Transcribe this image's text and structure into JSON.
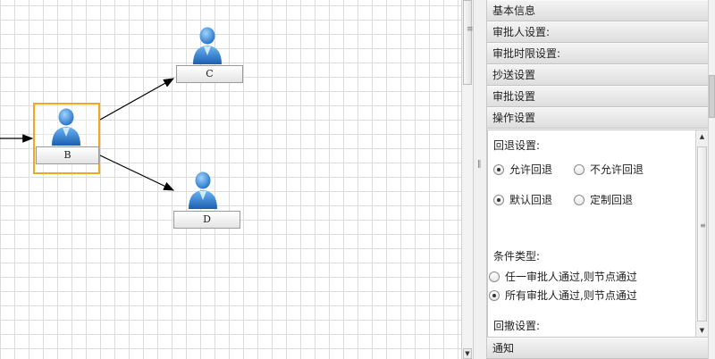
{
  "workflow": {
    "nodes": [
      {
        "id": "B",
        "label": "B",
        "selected": true
      },
      {
        "id": "C",
        "label": "C",
        "selected": false
      },
      {
        "id": "D",
        "label": "D",
        "selected": false
      }
    ],
    "avatar_icon": "user-avatar-icon",
    "selection_color": "#f2a81d"
  },
  "panel": {
    "sections": [
      {
        "label": "基本信息"
      },
      {
        "label": "审批人设置:"
      },
      {
        "label": "审批时限设置:"
      },
      {
        "label": "抄送设置"
      },
      {
        "label": "审批设置"
      },
      {
        "label": "操作设置"
      }
    ],
    "footer_section": "通知",
    "operation": {
      "rollback_title": "回退设置:",
      "allow_rollback": "允许回退",
      "disallow_rollback": "不允许回退",
      "default_rollback": "默认回退",
      "custom_rollback": "定制回退",
      "condition_title": "条件类型:",
      "any_approver": "任一审批人通过,则节点通过",
      "all_approvers": "所有审批人通过,则节点通过",
      "withdraw_title": "回撤设置:"
    }
  }
}
